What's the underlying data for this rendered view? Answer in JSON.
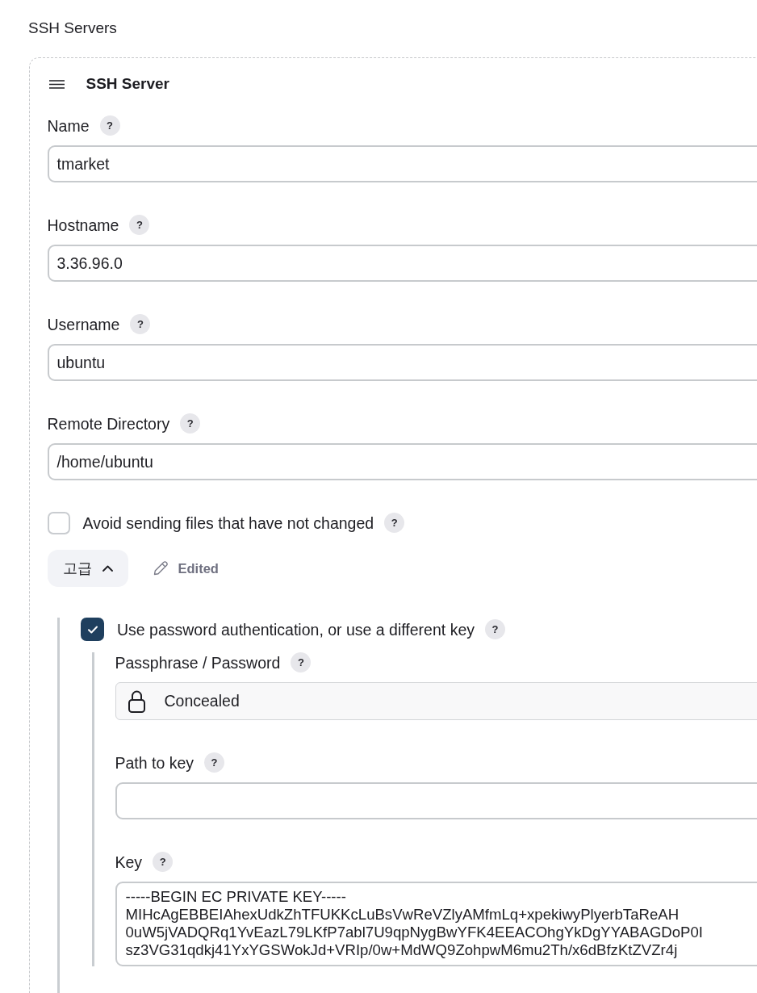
{
  "section_title": "SSH Servers",
  "server": {
    "title": "SSH Server",
    "fields": [
      {
        "kind": "text",
        "label": "Name",
        "help": "?",
        "value": "tmarket"
      },
      {
        "kind": "text",
        "label": "Hostname",
        "help": "?",
        "value": "3.36.96.0"
      },
      {
        "kind": "text",
        "label": "Username",
        "help": "?",
        "value": "ubuntu"
      },
      {
        "kind": "text",
        "label": "Remote Directory",
        "help": "?",
        "value": "/home/ubuntu"
      }
    ],
    "avoid_unchanged": {
      "label": "Avoid sending files that have not changed",
      "help": "?",
      "checked": false
    },
    "advanced": {
      "label": "고급",
      "expanded": true,
      "edited_label": "Edited"
    },
    "password_auth": {
      "label": "Use password authentication, or use a different key",
      "help": "?",
      "checked": true,
      "fields": [
        {
          "kind": "concealed",
          "label": "Passphrase / Password",
          "help": "?",
          "value": "Concealed"
        },
        {
          "kind": "text",
          "label": "Path to key",
          "help": "?"
        },
        {
          "kind": "textarea",
          "label": "Key",
          "help": "?",
          "value": "-----BEGIN EC PRIVATE KEY-----\nMIHcAgEBBEIAhexUdkZhTFUKKcLuBsVwReVZlyAMfmLq+xpekiwyPlyerbTaReAH\n0uW5jVADQRq1YvEazL79LKfP7abl7U9qpNygBwYFK4EEACOhgYkDgYYABAGDoP0I\nsz3VG31qdkj41YxYGSWokJd+VRIp/0w+MdWQ9ZohpwM6mu2Th/x6dBfzKtZVZr4j"
        }
      ]
    }
  }
}
